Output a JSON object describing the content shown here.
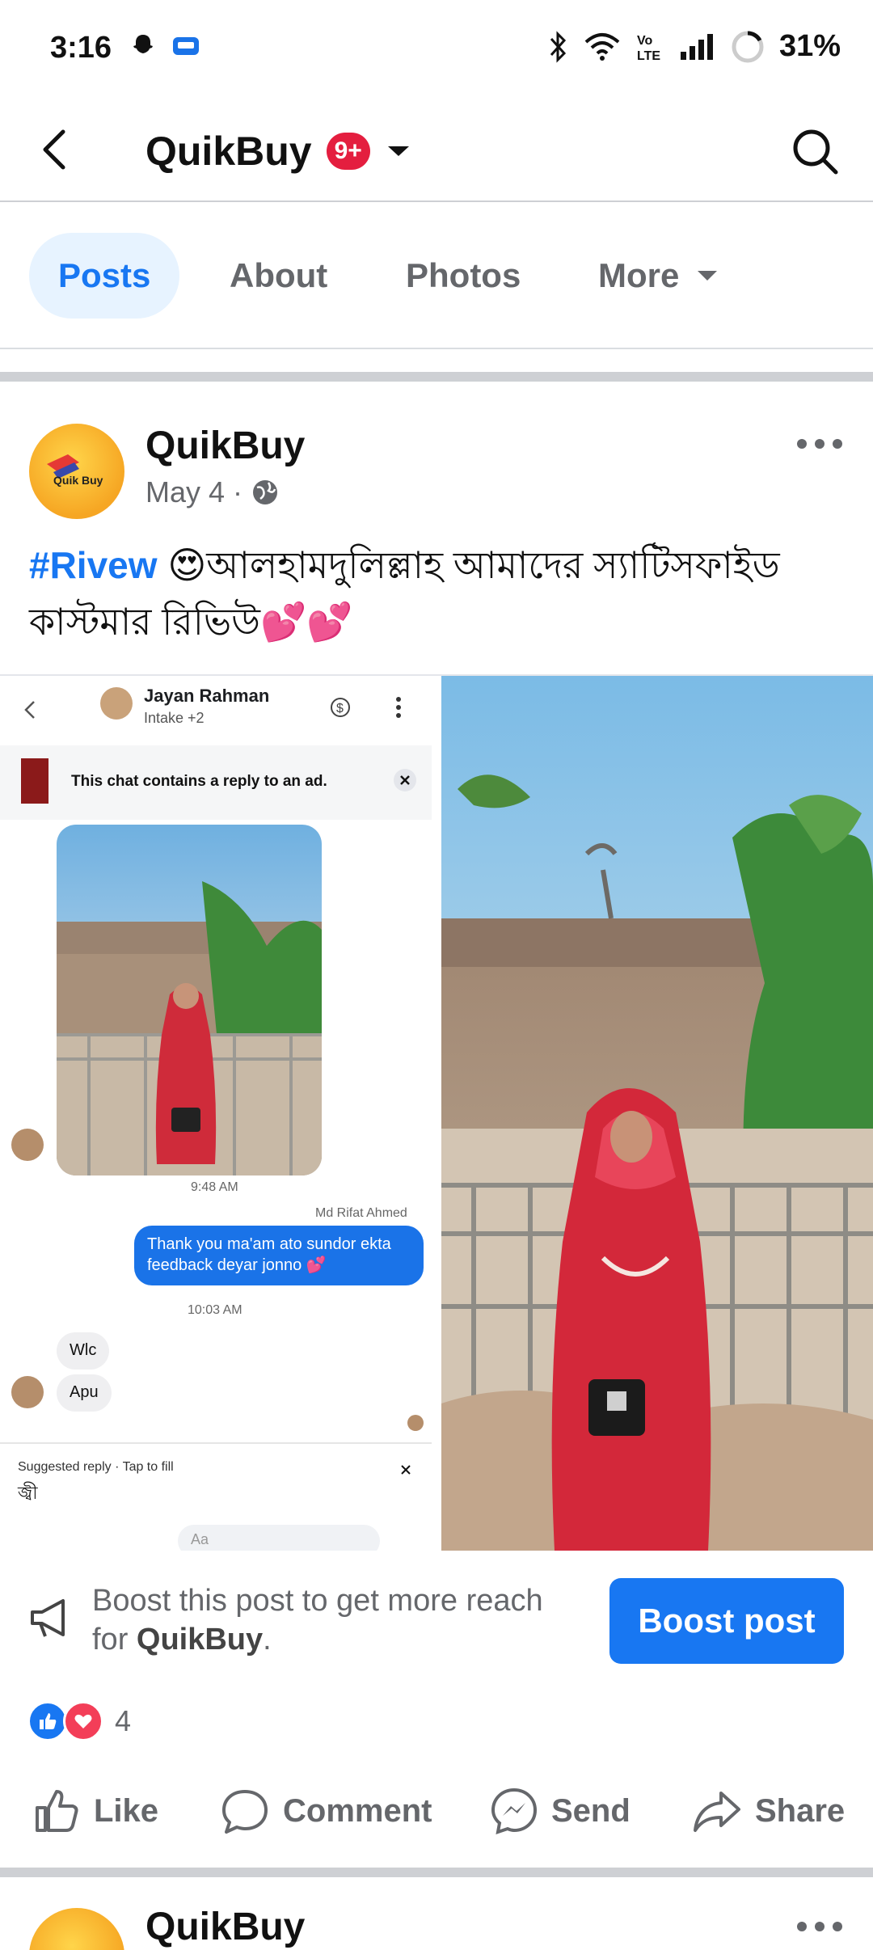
{
  "status_bar": {
    "time": "3:16",
    "battery": "31%",
    "icons_left": [
      "snapchat-icon",
      "app-notification-icon"
    ],
    "icons_right": [
      "bluetooth-icon",
      "wifi-icon",
      "volte-icon",
      "signal-icon",
      "battery-icon"
    ]
  },
  "header": {
    "title": "QuikBuy",
    "badge": "9+"
  },
  "tabs": [
    {
      "label": "Posts",
      "active": true
    },
    {
      "label": "About",
      "active": false
    },
    {
      "label": "Photos",
      "active": false
    },
    {
      "label": "More",
      "active": false
    }
  ],
  "post": {
    "page_name": "QuikBuy",
    "avatar_text": "Quik Buy",
    "date": "May 4",
    "hashtag": "#Rivew",
    "text": "😍আলহামদুলিল্লাহ আমাদের স্যাটিসফাইড কাস্টমার রিভিউ💕💕",
    "chat_screenshot": {
      "contact_name": "Jayan Rahman",
      "contact_sub": "Intake +2",
      "ad_notice": "This chat contains a reply to an ad.",
      "time1": "9:48 AM",
      "sender": "Md Rifat Ahmed",
      "reply": "Thank you ma'am ato sundor ekta feedback deyar jonno 💕",
      "time2": "10:03 AM",
      "msg1": "Wlc",
      "msg2": "Apu",
      "suggest_label": "Suggested reply · Tap to fill",
      "suggest_value": "জ্বী",
      "input_placeholder": "Aa"
    }
  },
  "boost": {
    "text_prefix": "Boost this post to get more reach for ",
    "text_page": "QuikBuy",
    "text_suffix": ".",
    "button": "Boost post"
  },
  "reactions": {
    "count": "4"
  },
  "actions": {
    "like": "Like",
    "comment": "Comment",
    "send": "Send",
    "share": "Share"
  },
  "next_post": {
    "page_name": "QuikBuy"
  },
  "colors": {
    "accent": "#1877f2",
    "badge": "#e41e3f",
    "love": "#f33e58"
  }
}
